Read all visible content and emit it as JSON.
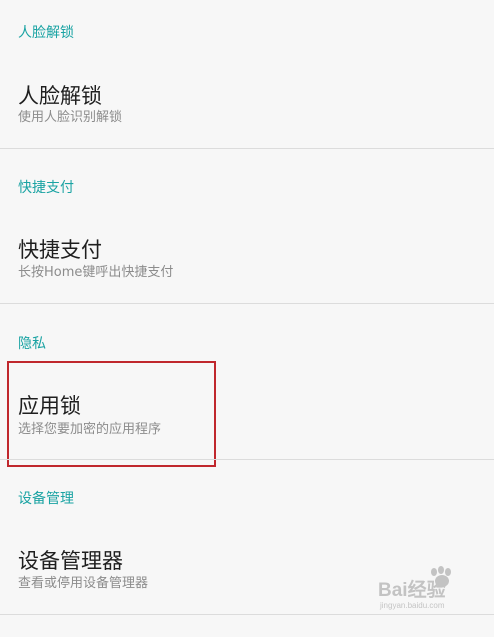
{
  "sections": [
    {
      "header": "人脸解锁",
      "item": {
        "title": "人脸解锁",
        "subtitle": "使用人脸识别解锁"
      }
    },
    {
      "header": "快捷支付",
      "item": {
        "title": "快捷支付",
        "subtitle": "长按Home键呼出快捷支付"
      }
    },
    {
      "header": "隐私",
      "item": {
        "title": "应用锁",
        "subtitle": "选择您要加密的应用程序"
      }
    },
    {
      "header": "设备管理",
      "item": {
        "title": "设备管理器",
        "subtitle": "查看或停用设备管理器"
      }
    }
  ],
  "watermark": {
    "brand": "Bai经验",
    "domain": "jingyan.baidu.com"
  },
  "colors": {
    "section_header": "#1aa3a3",
    "highlight": "#c0272d",
    "background": "#f7f7f7"
  }
}
